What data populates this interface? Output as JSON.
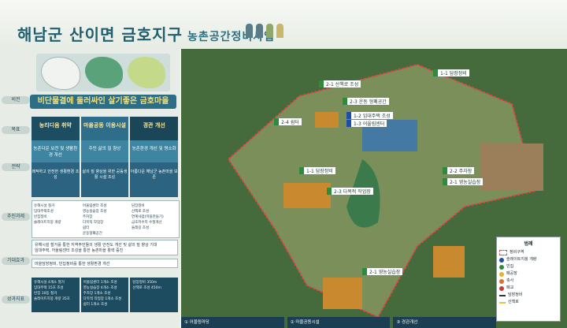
{
  "header": {
    "title": "해남군 산이면 금호지구",
    "subtitle": "농촌공간정비사업"
  },
  "left": {
    "labels": [
      "비전",
      "목표",
      "전략",
      "추진과제",
      "기대효과",
      "성과지표"
    ],
    "vision": "비단물결에 둘러싸인 살기좋은 금호마을",
    "goals": [
      "농리디움 취약",
      "마을공동 이용시설",
      "경관 개선"
    ],
    "strategies": [
      "농촌다운 보전 및 생활환경 개선",
      "주민 삶의 질 향상",
      "농촌환경 개선 및 명소화"
    ],
    "results": [
      "쾌적하고 안전한 생활환경 조성",
      "삶의 질 향상을 위한 공동생활 시설 조성",
      "아름다운 해남군 농촌마을 보존"
    ],
    "tasks": [
      [
        "유해시설 철거",
        "임대주택조성",
        "빈집정비",
        "슬레이트지붕 개량"
      ],
      [
        "어울림센터 조성",
        "영농실습장 조성",
        "주차장",
        "다목적 작업장",
        "쉼터",
        "운동형폐공간"
      ],
      [
        "담장정비",
        "산책로 조성",
        "연계사업(마을만들기)",
        "금호저수지 수질개선",
        "둘레길 조성"
      ]
    ],
    "expect1": "유해시설 철거를 통한 지역주민들의 생활 안전도 개선 및 삶의 질 향상 기대",
    "expect2": "임대주택, 어울림센터 조성을 통한 농촌마을 활력 증진",
    "expect3": "마을담장정비, 빈집정비를 통한 생활환경 개선",
    "kpi": [
      [
        "유해시설 4개소 철거",
        "임대주택 15호 조성",
        "빈집 10동 철거",
        "슬레이트지붕 개량 35호"
      ],
      [
        "어울림센터 1개소 조성",
        "영농실습장 4개소 조성",
        "주차장 1개소 조성",
        "다목적 작업장 1개소 조성",
        "쉼터 1개소 조성",
        "운동형폐공간 1개소 조성"
      ],
      [
        "담장정비 350m",
        "산책로 조성 450m"
      ]
    ]
  },
  "map": {
    "tags": [
      {
        "t": "2-1 산책로 조성",
        "c": "green"
      },
      {
        "t": "1-1 담장정비",
        "c": "green"
      },
      {
        "t": "2-3 운동 형폐공간",
        "c": "green"
      },
      {
        "t": "2-4 쉼터",
        "c": "green"
      },
      {
        "t": "1-2 임대주택 조성",
        "c": "blue"
      },
      {
        "t": "1-3 어울림센터",
        "c": "blue"
      },
      {
        "t": "1-1 담장정비",
        "c": "green"
      },
      {
        "t": "2-3 다목적 작업장",
        "c": "green"
      },
      {
        "t": "2-2 주차장",
        "c": "green"
      },
      {
        "t": "2-1 영농실습장",
        "c": "green"
      },
      {
        "t": "2-1 영농실습장",
        "c": "green"
      }
    ],
    "legend": {
      "title": "범례",
      "items": [
        "정비구역",
        "슬레이트지붕 개량",
        "빈집",
        "폐공장",
        "축사",
        "폐교",
        "담장정비",
        "산책로"
      ]
    },
    "bottom": [
      "① 어울림마당",
      "② 마을공동시설",
      "③ 경관개선"
    ]
  },
  "colors": {
    "title": "#1f5e6e",
    "boundary": "#d83a3a",
    "field": "#c9892f"
  }
}
